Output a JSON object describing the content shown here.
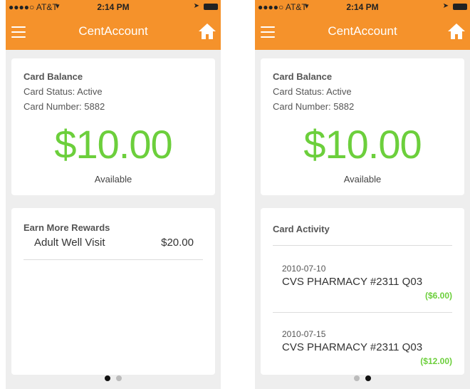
{
  "app": {
    "title": "CentAccount"
  },
  "status_bar": {
    "carrier": "●●●●○ AT&T",
    "time": "2:14 PM"
  },
  "balance": {
    "title": "Card Balance",
    "status": "Card Status: Active",
    "number": "Card Number: 5882",
    "amount": "$10.00",
    "available_label": "Available"
  },
  "rewards": {
    "title": "Earn More Rewards",
    "items": [
      {
        "name": "Adult Well Visit",
        "amount": "$20.00"
      }
    ]
  },
  "activity": {
    "title": "Card Activity",
    "items": [
      {
        "date": "2010-07-10",
        "merchant": "CVS PHARMACY #2311 Q03",
        "amount": "($6.00)"
      },
      {
        "date": "2010-07-15",
        "merchant": "CVS PHARMACY #2311 Q03",
        "amount": "($12.00)"
      }
    ]
  },
  "pager": {
    "left_active_index": 0,
    "right_active_index": 1,
    "count": 2
  },
  "colors": {
    "brand_orange": "#f5922b",
    "amount_green": "#6ccf3c",
    "background": "#eeeeee"
  },
  "icons": {
    "menu": "hamburger-menu-icon",
    "home": "home-icon",
    "wifi": "wifi-icon",
    "location": "location-arrow-icon",
    "battery": "battery-icon"
  }
}
